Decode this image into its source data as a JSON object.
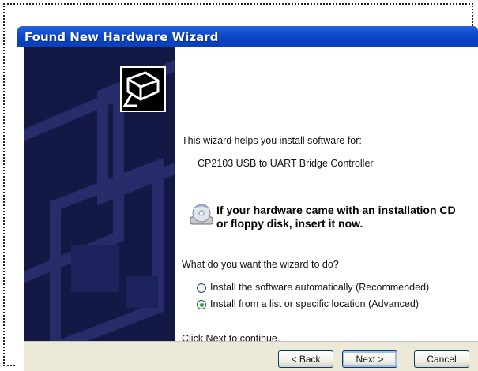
{
  "window": {
    "title": "Found New Hardware Wizard"
  },
  "content": {
    "intro": "This wizard helps you install software for:",
    "device": "CP2103 USB to UART Bridge Controller",
    "cd_notice_line1": "If your hardware came with an installation CD",
    "cd_notice_line2": "or floppy disk, insert it now.",
    "question": "What do you want the wizard to do?",
    "options": [
      {
        "label": "Install the software automatically (Recommended)",
        "selected": false
      },
      {
        "label": "Install from a list or specific location (Advanced)",
        "selected": true
      }
    ],
    "continue_hint": "Click Next to continue."
  },
  "buttons": {
    "back": "< Back",
    "next": "Next >",
    "cancel": "Cancel"
  },
  "colors": {
    "titlebar": "#0a45c6",
    "sidebar": "#141845",
    "footer": "#ece9d8",
    "radio_dot": "#26a82a"
  },
  "icons": {
    "wizard": "hardware-card-icon",
    "cd": "cd-drive-icon"
  }
}
